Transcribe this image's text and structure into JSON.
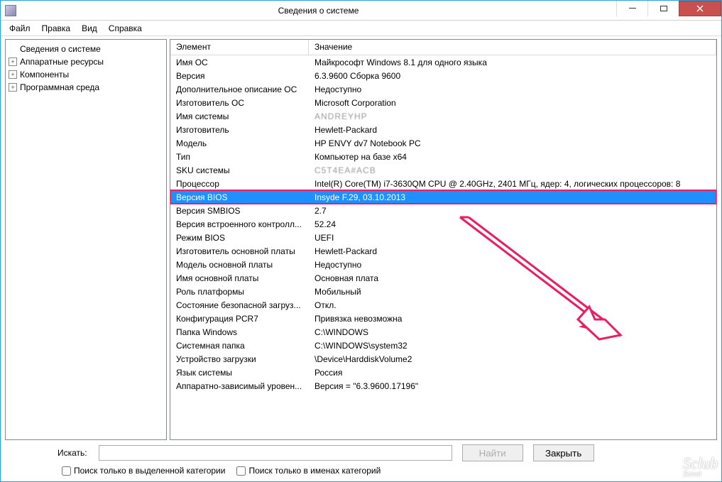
{
  "window": {
    "title": "Сведения о системе"
  },
  "menu": {
    "file": "Файл",
    "edit": "Правка",
    "view": "Вид",
    "help": "Справка"
  },
  "tree": {
    "root": "Сведения о системе",
    "items": [
      "Аппаратные ресурсы",
      "Компоненты",
      "Программная среда"
    ]
  },
  "grid": {
    "headers": {
      "element": "Элемент",
      "value": "Значение"
    },
    "rows": [
      {
        "k": "Имя ОС",
        "v": "Майкрософт Windows 8.1 для одного языка"
      },
      {
        "k": "Версия",
        "v": "6.3.9600 Сборка 9600"
      },
      {
        "k": "Дополнительное описание ОС",
        "v": "Недоступно"
      },
      {
        "k": "Изготовитель ОС",
        "v": "Microsoft Corporation"
      },
      {
        "k": "Имя системы",
        "v": "ANDREYHP",
        "obscured": true
      },
      {
        "k": "Изготовитель",
        "v": "Hewlett-Packard"
      },
      {
        "k": "Модель",
        "v": "HP ENVY dv7 Notebook PC"
      },
      {
        "k": "Тип",
        "v": "Компьютер на базе x64"
      },
      {
        "k": "SKU системы",
        "v": "C5T4EA#ACB",
        "obscured": true
      },
      {
        "k": "Процессор",
        "v": "Intel(R) Core(TM) i7-3630QM CPU @ 2.40GHz, 2401 МГц, ядер: 4, логических процессоров: 8"
      },
      {
        "k": "Версия BIOS",
        "v": "Insyde F.29, 03.10.2013",
        "selected": true
      },
      {
        "k": "Версия SMBIOS",
        "v": "2.7"
      },
      {
        "k": "Версия встроенного контролл...",
        "v": "52.24"
      },
      {
        "k": "Режим BIOS",
        "v": "UEFI"
      },
      {
        "k": "Изготовитель основной платы",
        "v": "Hewlett-Packard"
      },
      {
        "k": "Модель основной платы",
        "v": "Недоступно"
      },
      {
        "k": "Имя основной платы",
        "v": "Основная плата"
      },
      {
        "k": "Роль платформы",
        "v": "Мобильный"
      },
      {
        "k": "Состояние безопасной загруз...",
        "v": "Откл."
      },
      {
        "k": "Конфигурация PCR7",
        "v": "Привязка невозможна"
      },
      {
        "k": "Папка Windows",
        "v": "C:\\WINDOWS"
      },
      {
        "k": "Системная папка",
        "v": "C:\\WINDOWS\\system32"
      },
      {
        "k": "Устройство загрузки",
        "v": "\\Device\\HarddiskVolume2"
      },
      {
        "k": "Язык системы",
        "v": "Россия"
      },
      {
        "k": "Аппаратно-зависимый уровен...",
        "v": "Версия = \"6.3.9600.17196\""
      }
    ]
  },
  "footer": {
    "search_label": "Искать:",
    "find_button": "Найти",
    "close_button": "Закрыть",
    "chk_category": "Поиск только в выделенной категории",
    "chk_names": "Поиск только в именах категорий"
  },
  "watermark": {
    "top": "Sclub",
    "bottom": "Sovet"
  }
}
